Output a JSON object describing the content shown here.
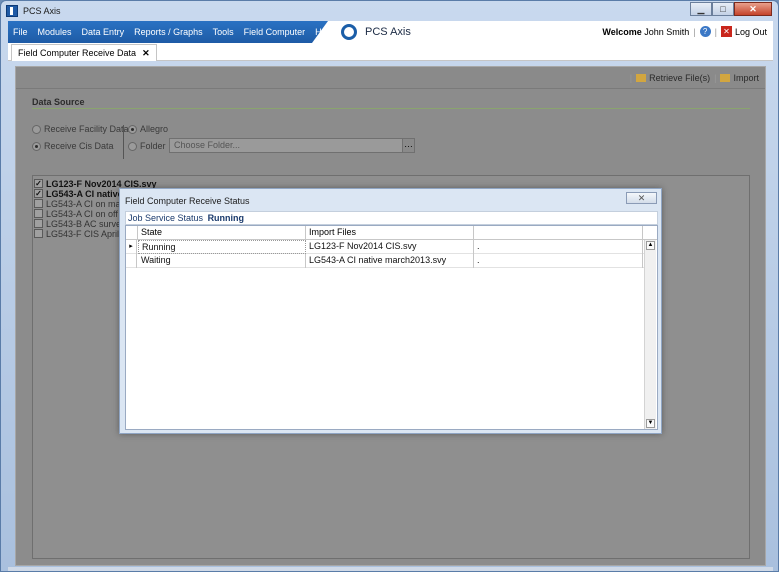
{
  "window": {
    "title": "PCS Axis"
  },
  "menu": {
    "items": [
      "File",
      "Modules",
      "Data Entry",
      "Reports / Graphs",
      "Tools",
      "Field Computer",
      "Help"
    ]
  },
  "brand": {
    "name": "PCS Axis"
  },
  "user": {
    "welcome": "Welcome",
    "name": "John Smith",
    "logout": "Log Out"
  },
  "tab": {
    "label": "Field Computer Receive Data"
  },
  "toolbar": {
    "retrieve": "Retrieve File(s)",
    "import": "Import"
  },
  "data_source": {
    "title": "Data Source",
    "receive_facility": "Receive Facility Data",
    "receive_cis": "Receive Cis Data",
    "allegro": "Allegro",
    "folder": "Folder",
    "folder_placeholder": "Choose Folder..."
  },
  "files": [
    {
      "name": "LG123-F Nov2014 CIS.svy",
      "checked": true
    },
    {
      "name": "LG543-A CI native",
      "checked": true
    },
    {
      "name": "LG543-A CI on marc",
      "checked": false
    },
    {
      "name": "LG543-A CI on off m",
      "checked": false
    },
    {
      "name": "LG543-B AC survey",
      "checked": false
    },
    {
      "name": "LG543-F CIS April20",
      "checked": false
    }
  ],
  "dialog": {
    "title": "Field Computer Receive Status",
    "close": "✕",
    "status_label": "Job Service Status",
    "status_value": "Running",
    "col_state": "State",
    "col_import": "Import Files",
    "rows": [
      {
        "state": "Running",
        "file": "LG123-F Nov2014 CIS.svy",
        "extra": "."
      },
      {
        "state": "Waiting",
        "file": "LG543-A CI native march2013.svy",
        "extra": "."
      }
    ]
  },
  "colors": {
    "menu_blue": "#2067b4",
    "accent_green": "#8aa46e",
    "dialog_bg": "#dbe6f3"
  }
}
